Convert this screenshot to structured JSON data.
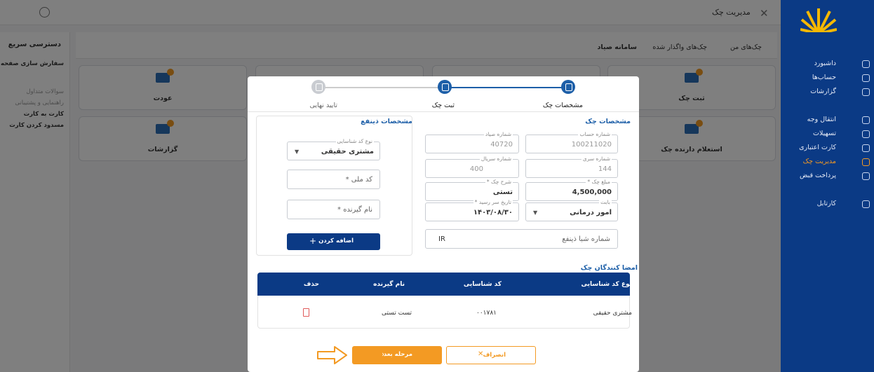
{
  "header": {
    "title": "مدیریت چک",
    "close_icon": "close-icon",
    "user_icon": "user-circle-icon"
  },
  "sidebar": {
    "items": [
      {
        "label": "داشبورد",
        "icon": "dashboard-icon"
      },
      {
        "label": "حساب‌ها",
        "icon": "bank-icon"
      },
      {
        "label": "گزارشات",
        "icon": "chart-icon"
      },
      {
        "label": "انتقال وجه",
        "icon": "transfer-icon"
      },
      {
        "label": "تسهیلات",
        "icon": "loan-icon"
      },
      {
        "label": "کارت اعتباری",
        "icon": "credit-card-icon"
      },
      {
        "label": "مدیریت چک",
        "icon": "cheque-icon",
        "active": true
      },
      {
        "label": "پرداخت قبض",
        "icon": "bill-icon"
      },
      {
        "label": "کارتابل",
        "icon": "briefcase-icon"
      }
    ]
  },
  "quick_access": {
    "title": "دسترسی سریع",
    "customize": "سفارش سازی صفحه",
    "items": [
      "سوالات متداول",
      "راهنمایی و پشتیبانی",
      "کارت به کارت",
      "مسدود کردن کارت"
    ]
  },
  "tabs": [
    "چک‌های من",
    "چک‌های واگذار شده",
    "سامانه صیاد"
  ],
  "cards": [
    "ثبت چک",
    "عودت",
    "استعلام دارنده چک",
    "گزارشات"
  ],
  "stepper": {
    "steps": [
      "مشخصات چک",
      "ثبت چک",
      "تایید نهایی"
    ]
  },
  "cheque_details": {
    "title": "مشخصات چک",
    "account_number": {
      "label": "شماره حساب",
      "value": "100211020"
    },
    "sayad_number": {
      "label": "شماره صیاد",
      "value": "40720"
    },
    "series_number": {
      "label": "شماره سری",
      "value": "144"
    },
    "serial_number": {
      "label": "شماره سریال",
      "value": "400"
    },
    "amount": {
      "label": "مبلغ چک *",
      "value": "4,500,000"
    },
    "description": {
      "label": "شرح چک *",
      "value": "تستی"
    },
    "reason": {
      "label": "بابت",
      "value": "امور درمانی"
    },
    "due_date": {
      "label": "تاریخ سر رسید *",
      "value": "۱۴۰۳/۰۸/۳۰"
    },
    "iban": {
      "placeholder": "شماره شبا ذینفع",
      "prefix": "IR"
    }
  },
  "beneficiary": {
    "title": "مشخصات ذینفع",
    "id_type": {
      "label": "نوع کد شناسایی",
      "value": "مشتری حقیقی"
    },
    "national_code": {
      "placeholder": "کد ملی *"
    },
    "receiver_name": {
      "placeholder": "نام گیرنده *"
    },
    "add_button": "اضافه کردن"
  },
  "signers": {
    "title": "امضا کنندگان چک",
    "columns": [
      "نوع کد شناسایی",
      "کد شناسایی",
      "نام گیرنده",
      "حذف"
    ],
    "rows": [
      {
        "id_type": "مشتری حقیقی",
        "id_code": "۰۰۱۷۸۱",
        "name": "تست تستی"
      }
    ]
  },
  "buttons": {
    "cancel": "انصراف",
    "next": "مرحله بعد"
  },
  "colors": {
    "primary": "#0b3a85",
    "accent": "#f39a23",
    "blue": "#1d5fa8"
  }
}
